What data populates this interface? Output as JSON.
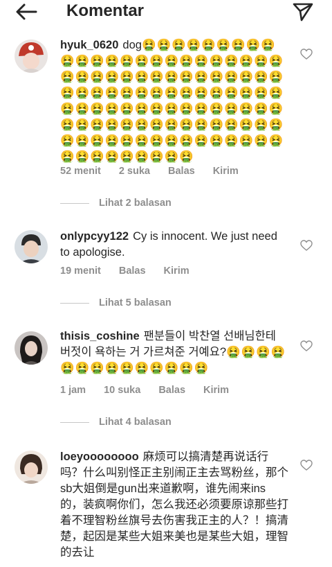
{
  "header": {
    "title": "Komentar",
    "back_icon": "arrow-left-icon",
    "send_icon": "paper-plane-icon"
  },
  "colors": {
    "text": "#262626",
    "muted": "#8e8e8e",
    "divider": "#c7c7c7"
  },
  "comments": [
    {
      "username": "hyuk_0620",
      "text": "dog",
      "emoji": "🤮🤮🤮🤮🤮🤮🤮🤮🤮🤮🤮🤮🤮🤮🤮🤮🤮🤮🤮🤮🤮🤮🤮🤮🤮🤮🤮🤮🤮🤮🤮🤮🤮🤮🤮🤮🤮🤮🤮🤮🤮🤮🤮🤮🤮🤮🤮🤮🤮🤮🤮🤮🤮🤮🤮🤮🤮🤮🤮🤮🤮🤮🤮🤮🤮🤮🤮🤮🤮🤮🤮🤮🤮🤮🤮🤮🤮🤮🤮🤮🤮🤮🤮🤮🤮🤮🤮🤮🤮🤮🤮🤮🤮🤮🤮🤮🤮🤮🤮🤮🤮🤮🤮🤮🤮🤮🤮🤮",
      "time": "52 menit",
      "likes": "2 suka",
      "reply": "Balas",
      "send": "Kirim",
      "view_replies": "Lihat 2 balasan"
    },
    {
      "username": "onlypcyy122",
      "text": "Cy is innocent. We just need to apologise.",
      "time": "19 menit",
      "reply": "Balas",
      "send": "Kirim",
      "view_replies": "Lihat 5 balasan"
    },
    {
      "username": "thisis_coshine",
      "text": "팬분들이 박찬열 선배님한테 버젓이 욕하는 거 가르쳐준 거예요?",
      "emoji": "🤮🤮🤮🤮🤮🤮🤮🤮🤮🤮🤮🤮🤮🤮",
      "time": "1 jam",
      "likes": "10 suka",
      "reply": "Balas",
      "send": "Kirim",
      "view_replies": "Lihat 4 balasan"
    },
    {
      "username": "loeyoooooooo",
      "text": "麻烦可以搞清楚再说话行吗？什么叫别怪正主别闹正主去骂粉丝，那个sb大姐倒是gun出来道歉啊，谁先闹来ins的，装疯啊你们，怎么我还必须要原谅那些打着不理智粉丝旗号去伤害我正主的人？！搞清楚，起因是某些大姐来美也是某些大姐，理智的去让"
    }
  ]
}
